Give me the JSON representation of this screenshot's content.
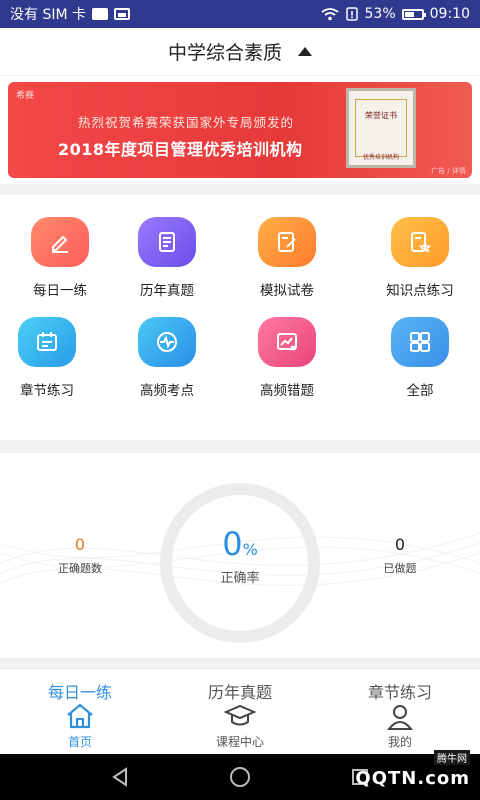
{
  "status_bar": {
    "carrier": "没有 SIM 卡",
    "battery_pct": "53%",
    "battery_level": 0.53,
    "time": "09:10"
  },
  "header": {
    "title": "中学综合素质"
  },
  "banner": {
    "logo": "希赛",
    "line1": "热烈祝贺希赛荣获国家外专局颁发的",
    "line2": "2018年度项目管理优秀培训机构",
    "cert_title": "荣誉证书",
    "cert_text": "优秀培训机构",
    "tag": "广告 / 详情"
  },
  "grid": {
    "items": [
      {
        "label": "每日一练",
        "icon": "pencil-icon",
        "color": "#ff6a5a"
      },
      {
        "label": "历年真题",
        "icon": "document-icon",
        "color": "#7b5cf5"
      },
      {
        "label": "模拟试卷",
        "icon": "exam-icon",
        "color": "#ff8a3a"
      },
      {
        "label": "知识点练习",
        "icon": "star-doc-icon",
        "color": "#ffa43a"
      },
      {
        "label": "章节练习",
        "icon": "calendar-icon",
        "color": "#2bb3f0"
      },
      {
        "label": "高频考点",
        "icon": "pulse-icon",
        "color": "#2bb0f0"
      },
      {
        "label": "高频错题",
        "icon": "chart-error-icon",
        "color": "#f25a8a"
      },
      {
        "label": "全部",
        "icon": "grid-icon",
        "color": "#3aa3f0"
      }
    ]
  },
  "stats": {
    "correct_count": "0",
    "correct_count_label": "正确题数",
    "accuracy_num": "0",
    "accuracy_unit": "%",
    "accuracy_label": "正确率",
    "done_count": "0",
    "done_label": "已做题"
  },
  "bottom_tabs": {
    "top": [
      "每日一练",
      "历年真题",
      "章节练习"
    ],
    "items": [
      {
        "label": "首页",
        "icon": "home-icon",
        "active": true
      },
      {
        "label": "课程中心",
        "icon": "graduation-cap-icon",
        "active": false
      },
      {
        "label": "我的",
        "icon": "user-icon",
        "active": false
      }
    ],
    "active_color": "#2f8fe0",
    "inactive_color": "#555555"
  },
  "nav": {
    "watermark": "QQTN.com",
    "watermark_small": "腾牛网"
  }
}
